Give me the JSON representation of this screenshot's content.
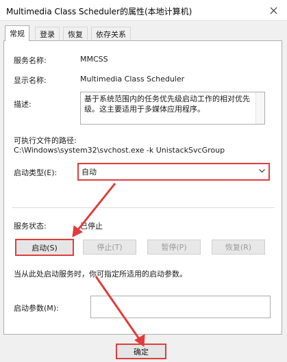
{
  "window": {
    "title": "Multimedia Class Scheduler的属性(本地计算机)"
  },
  "tabs": [
    {
      "label": "常规"
    },
    {
      "label": "登录"
    },
    {
      "label": "恢复"
    },
    {
      "label": "依存关系"
    }
  ],
  "general": {
    "service_name_label": "服务名称:",
    "service_name": "MMCSS",
    "display_name_label": "显示名称:",
    "display_name": "Multimedia Class Scheduler",
    "description_label": "描述:",
    "description": "基于系统范围内的任务优先级启动工作的相对优先级。这主要适用于多媒体应用程序。",
    "exe_path_label": "可执行文件的路径:",
    "exe_path": "C:\\Windows\\system32\\svchost.exe -k UnistackSvcGroup",
    "startup_type_label": "启动类型(E):",
    "startup_type": "自动",
    "status_label": "服务状态:",
    "status": "已停止",
    "buttons": {
      "start": "启动(S)",
      "stop": "停止(T)",
      "pause": "暂停(P)",
      "resume": "恢复(R)"
    },
    "hint": "当从此处启动服务时，你可指定所适用的启动参数。",
    "params_label": "启动参数(M):",
    "params_value": ""
  },
  "footer": {
    "ok": "确定"
  },
  "colors": {
    "highlight": "#e23b3b"
  },
  "icons": {
    "close": "close-icon",
    "dropdown": "chevron-down-icon"
  }
}
